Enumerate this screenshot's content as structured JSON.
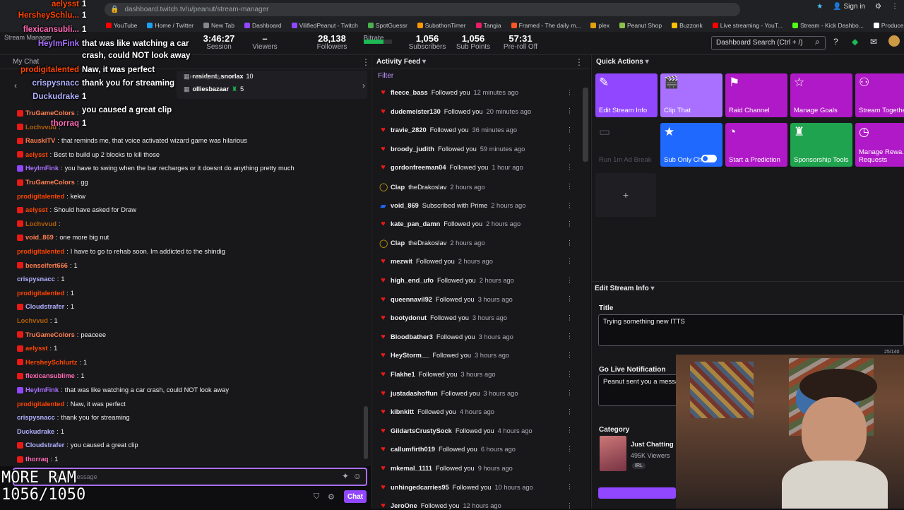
{
  "browser": {
    "url": "dashboard.twitch.tv/u/peanut/stream-manager",
    "bookmarks": [
      "YouTube",
      "Home / Twitter",
      "New Tab",
      "Dashboard",
      "VilifiedPeanut - Twitch",
      "SpotGuessr",
      "SubathonTimer",
      "Tangia",
      "Framed - The daily m...",
      "plex",
      "Peanut Shop",
      "Buzzonk",
      "Live streaming - YouT...",
      "Stream - Kick Dashbo...",
      "Producer - X Media St..."
    ],
    "bookmark_colors": [
      "#ff0000",
      "#1da1f2",
      "#888888",
      "#9147ff",
      "#9147ff",
      "#4caf50",
      "#ff9800",
      "#e91e63",
      "#ff5722",
      "#e5a00d",
      "#8bc34a",
      "#ffc107",
      "#ff0000",
      "#53fc18",
      "#ffffff"
    ],
    "sign_in": "Sign in"
  },
  "header": {
    "title": "Stream Manager",
    "stats": [
      {
        "value": "3:46:27",
        "label": "Session"
      },
      {
        "value": "–",
        "label": "Viewers"
      },
      {
        "value": "28,138",
        "label": "Followers"
      },
      {
        "value": "",
        "label": "Bitrate"
      },
      {
        "value": "1,056",
        "label": "Subscribers"
      },
      {
        "value": "1,056",
        "label": "Sub Points"
      },
      {
        "value": "57:31",
        "label": "Pre-roll Off"
      }
    ],
    "search_placeholder": "Dashboard Search (Ctrl + /)"
  },
  "chat": {
    "title": "My Chat",
    "pinned": [
      {
        "user": "resident_snorlax",
        "count": "10"
      },
      {
        "user": "olliesbazaar",
        "count": "5"
      }
    ],
    "overlay_pinned": "greatmaymay",
    "messages": [
      {
        "user": "TruGameColors",
        "text": "",
        "color": "#ff7f50",
        "badge": "#e91916"
      },
      {
        "user": "Lochvvud",
        "text": "",
        "color": "#b45f06",
        "badge": "#e91916"
      },
      {
        "user": "RauskiTV",
        "text": "that reminds me, that voice activated wizard game was hilarious",
        "color": "#ff7f50",
        "badge": "#e91916"
      },
      {
        "user": "aelysst",
        "text": "Best to build up 2 blocks to kill those",
        "color": "#ff4500",
        "badge": "#e91916"
      },
      {
        "user": "HeyImFink",
        "text": "you have to swing when the bar recharges or it doesnt do anything pretty much",
        "color": "#a970ff",
        "badge": "#9147ff"
      },
      {
        "user": "TruGameColors",
        "text": "gg",
        "color": "#ff7f50",
        "badge": "#e91916"
      },
      {
        "user": "prodigitalented",
        "text": "kekw",
        "color": "#ff4500",
        "badge": ""
      },
      {
        "user": "aelysst",
        "text": "Should have asked for Draw",
        "color": "#ff4500",
        "badge": "#e91916"
      },
      {
        "user": "Lochvvud",
        "text": "",
        "color": "#b45f06",
        "badge": "#e91916"
      },
      {
        "user": "void_869",
        "text": "one more big nut",
        "color": "#ff7f50",
        "badge": "#e91916"
      },
      {
        "user": "prodigitalented",
        "text": "I have to go to rehab soon. Im addicted to the shindig",
        "color": "#ff4500",
        "badge": ""
      },
      {
        "user": "benseifert666",
        "text": "1",
        "color": "#ff7f50",
        "badge": "#e91916"
      },
      {
        "user": "crispysnacc",
        "text": "1",
        "color": "#b1b1ff",
        "badge": ""
      },
      {
        "user": "prodigitalented",
        "text": "1",
        "color": "#ff4500",
        "badge": ""
      },
      {
        "user": "Cloudstrafer",
        "text": "1",
        "color": "#b1b1ff",
        "badge": "#e91916"
      },
      {
        "user": "Lochvvud",
        "text": "1",
        "color": "#b45f06",
        "badge": ""
      },
      {
        "user": "TruGameColors",
        "text": "peaceee",
        "color": "#ff7f50",
        "badge": "#e91916"
      },
      {
        "user": "aelysst",
        "text": "1",
        "color": "#ff4500",
        "badge": "#e91916"
      },
      {
        "user": "HersheySchlurtz",
        "text": "1",
        "color": "#ff4500",
        "badge": "#e91916"
      },
      {
        "user": "flexicansublime",
        "text": "1",
        "color": "#ff69b4",
        "badge": "#e91916"
      },
      {
        "user": "HeyImFink",
        "text": "that was like watching a car crash, could NOT look away",
        "color": "#a970ff",
        "badge": "#9147ff"
      },
      {
        "user": "prodigitalented",
        "text": "Naw, it was perfect",
        "color": "#ff4500",
        "badge": ""
      },
      {
        "user": "crispysnacc",
        "text": "thank you for streaming",
        "color": "#b1b1ff",
        "badge": ""
      },
      {
        "user": "Duckudrake",
        "text": "1",
        "color": "#b1b1ff",
        "badge": ""
      },
      {
        "user": "Cloudstrafer",
        "text": "you caused a great clip",
        "color": "#b1b1ff",
        "badge": "#e91916"
      },
      {
        "user": "thorraq",
        "text": "1",
        "color": "#ff69b4",
        "badge": "#e91916"
      }
    ],
    "input_placeholder": "Send a message",
    "chat_button": "Chat"
  },
  "overlay": {
    "lines": [
      {
        "user": "aelysst",
        "text": "1",
        "color": "#ff4500"
      },
      {
        "user": "HersheySchlu...",
        "text": "1",
        "color": "#ff4500"
      },
      {
        "user": "flexicansubli...",
        "text": "1",
        "color": "#ff69b4"
      },
      {
        "user": "HeyImFink",
        "text": "that was like watching a car",
        "color": "#a970ff"
      },
      {
        "user": "",
        "text": "crash, could NOT look away",
        "color": "#fff"
      },
      {
        "user": "prodigitalented",
        "text": "Naw, it was perfect",
        "color": "#ff4500"
      },
      {
        "user": "crispysnacc",
        "text": "thank you for streaming",
        "color": "#b1b1ff"
      },
      {
        "user": "Duckudrake",
        "text": "1",
        "color": "#b1b1ff"
      },
      {
        "user": "",
        "text": "you caused a great clip",
        "color": "#fff"
      },
      {
        "user": "thorraq",
        "text": "1",
        "color": "#ff69b4"
      }
    ],
    "big_text_1": "MORE RAM",
    "big_text_2": "1056/1050"
  },
  "activity": {
    "title": "Activity Feed",
    "filter": "Filter",
    "items": [
      {
        "user": "fleece_bass",
        "action": "Followed you",
        "time": "12 minutes ago",
        "icon": "heart"
      },
      {
        "user": "dudemeister130",
        "action": "Followed you",
        "time": "20 minutes ago",
        "icon": "heart"
      },
      {
        "user": "travie_2820",
        "action": "Followed you",
        "time": "36 minutes ago",
        "icon": "heart"
      },
      {
        "user": "broody_judith",
        "action": "Followed you",
        "time": "59 minutes ago",
        "icon": "heart"
      },
      {
        "user": "gordonfreeman04",
        "action": "Followed you",
        "time": "1 hour ago",
        "icon": "heart"
      },
      {
        "user": "Clap",
        "action": "theDrakoslav",
        "time": "2 hours ago",
        "icon": "clap"
      },
      {
        "user": "void_869",
        "action": "Subscribed with Prime",
        "time": "2 hours ago",
        "icon": "prime"
      },
      {
        "user": "kate_pan_damn",
        "action": "Followed you",
        "time": "2 hours ago",
        "icon": "heart"
      },
      {
        "user": "Clap",
        "action": "theDrakoslav",
        "time": "2 hours ago",
        "icon": "clap"
      },
      {
        "user": "mezwit",
        "action": "Followed you",
        "time": "2 hours ago",
        "icon": "heart"
      },
      {
        "user": "high_end_ufo",
        "action": "Followed you",
        "time": "2 hours ago",
        "icon": "heart"
      },
      {
        "user": "queennavil92",
        "action": "Followed you",
        "time": "3 hours ago",
        "icon": "heart"
      },
      {
        "user": "bootydonut",
        "action": "Followed you",
        "time": "3 hours ago",
        "icon": "heart"
      },
      {
        "user": "Bloodbather3",
        "action": "Followed you",
        "time": "3 hours ago",
        "icon": "heart"
      },
      {
        "user": "HeyStorm__",
        "action": "Followed you",
        "time": "3 hours ago",
        "icon": "heart"
      },
      {
        "user": "Flakhe1",
        "action": "Followed you",
        "time": "3 hours ago",
        "icon": "heart"
      },
      {
        "user": "justadashoffun",
        "action": "Followed you",
        "time": "3 hours ago",
        "icon": "heart"
      },
      {
        "user": "kibnkitt",
        "action": "Followed you",
        "time": "4 hours ago",
        "icon": "heart"
      },
      {
        "user": "GildartsCrustySock",
        "action": "Followed you",
        "time": "4 hours ago",
        "icon": "heart"
      },
      {
        "user": "callumfirth019",
        "action": "Followed you",
        "time": "6 hours ago",
        "icon": "heart"
      },
      {
        "user": "mkemal_1111",
        "action": "Followed you",
        "time": "9 hours ago",
        "icon": "heart"
      },
      {
        "user": "unhingedcarries95",
        "action": "Followed you",
        "time": "10 hours ago",
        "icon": "heart"
      },
      {
        "user": "JeroOne",
        "action": "Followed you",
        "time": "12 hours ago",
        "icon": "heart"
      }
    ]
  },
  "quick_actions": {
    "title": "Quick Actions",
    "tiles": [
      {
        "label": "Edit Stream Info",
        "color": "#9147ff",
        "icon": "pencil-icon",
        "glyph": "✎"
      },
      {
        "label": "Clip That",
        "color": "#a970ff",
        "icon": "clapper-icon",
        "glyph": "🎬"
      },
      {
        "label": "Raid Channel",
        "color": "#b019c7",
        "icon": "raid-icon",
        "glyph": "⚑"
      },
      {
        "label": "Manage Goals",
        "color": "#b019c7",
        "icon": "star-icon",
        "glyph": "☆"
      },
      {
        "label": "Stream Together",
        "color": "#b019c7",
        "icon": "people-icon",
        "glyph": "⚇"
      },
      {
        "label": "Run 1m Ad Break",
        "color": "#18181b",
        "icon": "ad-icon",
        "glyph": "▭"
      },
      {
        "label": "Sub Only Chat",
        "color": "#1f69ff",
        "icon": "star-filled-icon",
        "glyph": "★"
      },
      {
        "label": "Start a Prediction",
        "color": "#b019c7",
        "icon": "prediction-icon",
        "glyph": "◔"
      },
      {
        "label": "Sponsorship Tools",
        "color": "#20a34f",
        "icon": "sponsor-icon",
        "glyph": "♜"
      },
      {
        "label": "Manage Rewa... Requests",
        "color": "#b019c7",
        "icon": "reward-icon",
        "glyph": "◷"
      }
    ],
    "add": "+"
  },
  "stream_info": {
    "title": "Edit Stream Info",
    "title_label": "Title",
    "title_value": "Trying something new ITTS",
    "char_count": "25/140",
    "notif_label": "Go Live Notification",
    "notif_value": "Peanut sent you a messa",
    "category_label": "Category",
    "category_name": "Just Chatting",
    "category_viewers": "495K Viewers",
    "category_tag": "IRL"
  }
}
